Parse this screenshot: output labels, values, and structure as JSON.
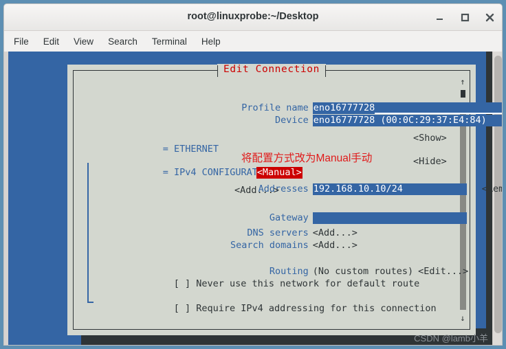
{
  "window": {
    "title": "root@linuxprobe:~/Desktop",
    "buttons": [
      {
        "name": "minimize",
        "glyph": "_"
      },
      {
        "name": "maximize",
        "glyph": "□"
      },
      {
        "name": "close",
        "glyph": "✕"
      }
    ]
  },
  "menubar": {
    "items": [
      "File",
      "Edit",
      "View",
      "Search",
      "Terminal",
      "Help"
    ]
  },
  "dialog": {
    "title": "Edit Connection",
    "title_color": "#cc0000",
    "fields": {
      "profile_name_label": "Profile name",
      "profile_name_value": "eno16777728",
      "device_label": "Device",
      "device_value": "eno16777728 (00:0C:29:37:E4:84)"
    },
    "ethernet": {
      "marker": "=",
      "label": "ETHERNET",
      "action": "<Show>"
    },
    "ipv4": {
      "marker": "=",
      "label": "IPv4 CONFIGURATION",
      "method": "<Manual>",
      "method_bg": "#cc0000",
      "action": "<Hide>",
      "addresses_label": "Addresses",
      "addresses_value": "192.168.10.10/24",
      "addresses_remove": "<Remove>",
      "addresses_add": "<Add...>",
      "gateway_label": "Gateway",
      "gateway_value": "",
      "dns_label": "DNS servers",
      "dns_add": "<Add...>",
      "search_label": "Search domains",
      "search_add": "<Add...>",
      "routing_label": "Routing",
      "routing_value": "(No custom routes)",
      "routing_edit": "<Edit...>",
      "never_default_checkbox": "[ ]",
      "never_default_label": "Never use this network for default route",
      "require_ipv4_checkbox": "[ ]",
      "require_ipv4_label": "Require IPv4 addressing for this connection"
    },
    "scrollbar": {
      "up_arrow": "↑",
      "down_arrow": "↓"
    }
  },
  "annotation": {
    "text": "将配置方式改为Manual手动",
    "color": "#e01b1b"
  },
  "watermark": {
    "text": "CSDN @lamb小羊"
  }
}
